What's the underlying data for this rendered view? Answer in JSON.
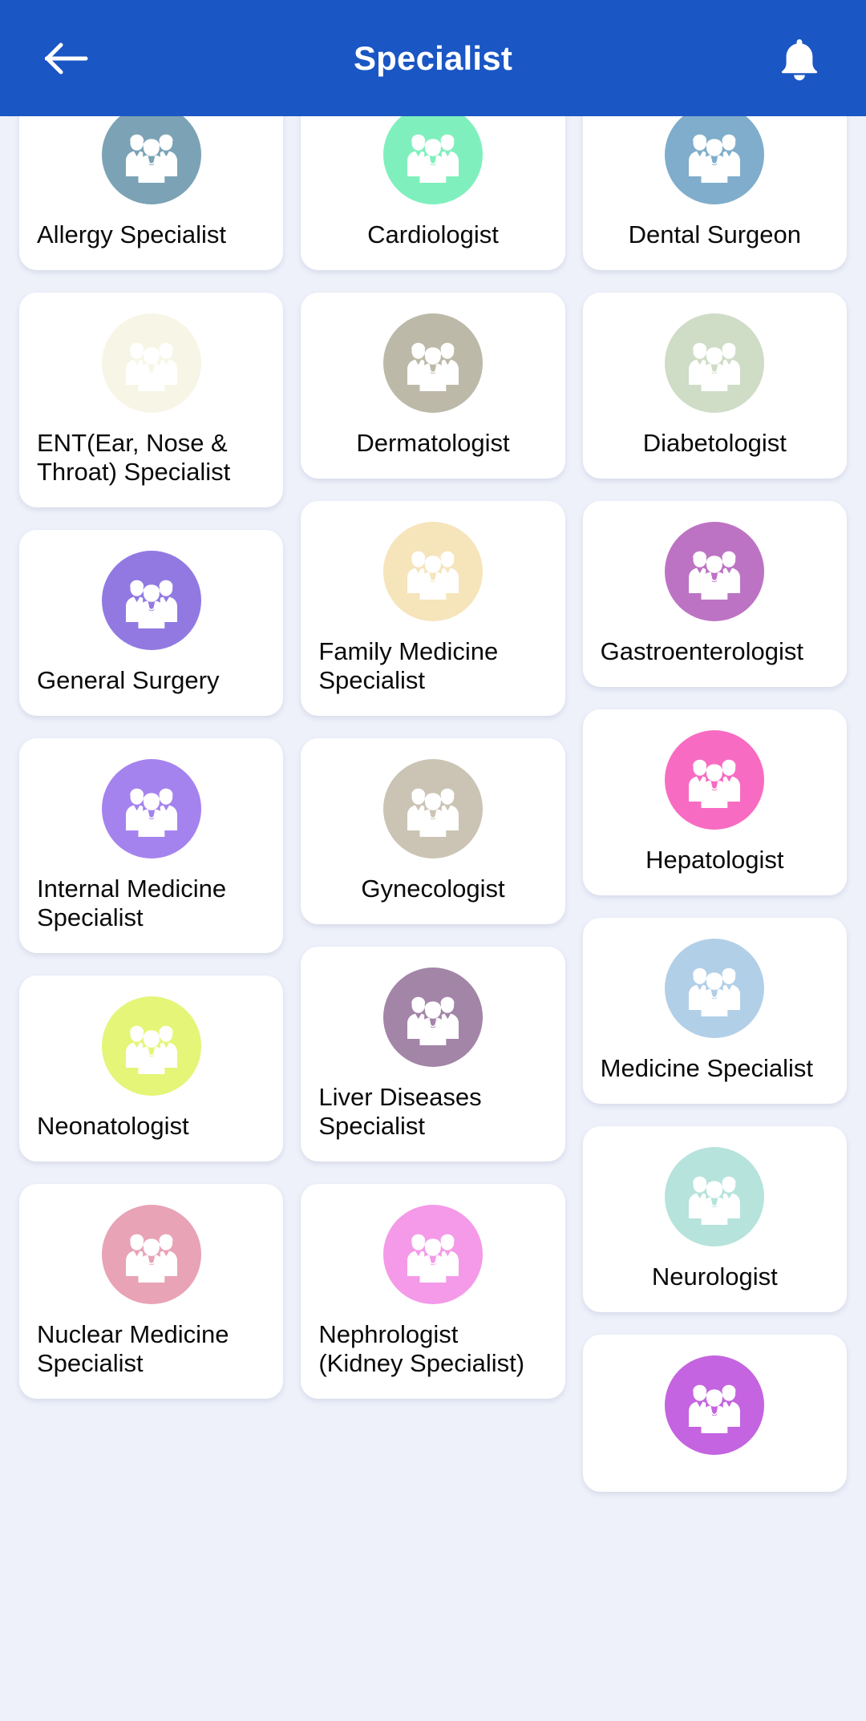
{
  "appbar": {
    "title": "Specialist",
    "back_icon": "arrow-left-icon",
    "notification_icon": "bell-icon",
    "background_color": "#1a56c4"
  },
  "theme": {
    "page_background": "#eef1fa",
    "card_background": "#ffffff",
    "label_color": "#0a0a0a"
  },
  "specialists": {
    "columns": [
      {
        "items": [
          {
            "label": "Allergy Specialist",
            "color": "#7ba3b5",
            "icon": "doctors-group-icon",
            "wrap": true
          },
          {
            "label": "ENT(Ear, Nose & Throat) Specialist",
            "color": "#f7f6e6",
            "icon": "doctors-group-icon",
            "wrap": true
          },
          {
            "label": "General Surgery",
            "color": "#9279e2",
            "icon": "doctors-group-icon",
            "wrap": false
          },
          {
            "label": "Internal Medicine Specialist",
            "color": "#a583ee",
            "icon": "doctors-group-icon",
            "wrap": true
          },
          {
            "label": "Neonatologist",
            "color": "#e5f578",
            "icon": "doctors-group-icon",
            "wrap": false
          },
          {
            "label": "Nuclear Medicine Specialist",
            "color": "#e8a3b6",
            "icon": "doctors-group-icon",
            "wrap": true
          }
        ]
      },
      {
        "items": [
          {
            "label": "Cardiologist",
            "color": "#7ff0bd",
            "icon": "doctors-group-icon",
            "wrap": false
          },
          {
            "label": "Dermatologist",
            "color": "#bdb9a8",
            "icon": "doctors-group-icon",
            "wrap": false
          },
          {
            "label": "Family Medicine Specialist",
            "color": "#f6e4bb",
            "icon": "doctors-group-icon",
            "wrap": true
          },
          {
            "label": "Gynecologist",
            "color": "#cbc4b4",
            "icon": "doctors-group-icon",
            "wrap": false
          },
          {
            "label": "Liver Diseases Specialist",
            "color": "#a385a8",
            "icon": "doctors-group-icon",
            "wrap": true
          },
          {
            "label": "Nephrologist (Kidney Specialist)",
            "color": "#f49ae8",
            "icon": "doctors-group-icon",
            "wrap": true
          }
        ]
      },
      {
        "items": [
          {
            "label": "Dental Surgeon",
            "color": "#7fadcb",
            "icon": "doctors-group-icon",
            "wrap": false
          },
          {
            "label": "Diabetologist",
            "color": "#cfdcc6",
            "icon": "doctors-group-icon",
            "wrap": false
          },
          {
            "label": "Gastroenterologist",
            "color": "#bd73c4",
            "icon": "doctors-group-icon",
            "wrap": true
          },
          {
            "label": "Hepatologist",
            "color": "#f76cc2",
            "icon": "doctors-group-icon",
            "wrap": false
          },
          {
            "label": "Medicine Specialist",
            "color": "#b2cfe8",
            "icon": "doctors-group-icon",
            "wrap": true
          },
          {
            "label": "Neurologist",
            "color": "#b6e3db",
            "icon": "doctors-group-icon",
            "wrap": false
          },
          {
            "label": "",
            "color": "#c464e0",
            "icon": "doctors-group-icon",
            "wrap": false
          }
        ]
      }
    ]
  }
}
